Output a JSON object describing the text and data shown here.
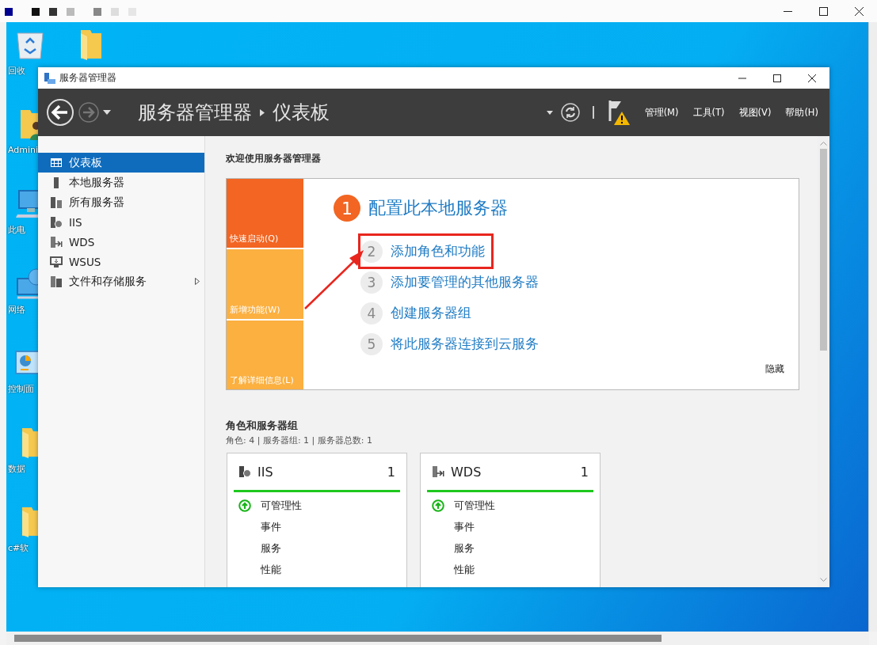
{
  "desktop_icons": [
    {
      "kind": "recycle-bin",
      "label": "回收"
    },
    {
      "kind": "folder"
    },
    {
      "kind": "user-folder",
      "label": "Admini"
    },
    {
      "kind": "computer",
      "label": "此电"
    },
    {
      "kind": "network",
      "label": "网络"
    },
    {
      "kind": "control-panel",
      "label": "控制面"
    },
    {
      "kind": "folder",
      "label": "数据"
    },
    {
      "kind": "folder",
      "label": "c#软"
    }
  ],
  "window": {
    "title": "服务器管理器"
  },
  "header": {
    "breadcrumb": [
      "服务器管理器",
      "仪表板"
    ],
    "menus": [
      "管理(M)",
      "工具(T)",
      "视图(V)",
      "帮助(H)"
    ]
  },
  "sidebar": {
    "items": [
      {
        "kind": "dashboard",
        "label": "仪表板",
        "selected": true,
        "has_submenu": false
      },
      {
        "kind": "server",
        "label": "本地服务器",
        "selected": false,
        "has_submenu": false
      },
      {
        "kind": "servers",
        "label": "所有服务器",
        "selected": false,
        "has_submenu": false
      },
      {
        "kind": "iis",
        "label": "IIS",
        "selected": false,
        "has_submenu": false
      },
      {
        "kind": "wds",
        "label": "WDS",
        "selected": false,
        "has_submenu": false
      },
      {
        "kind": "wsus",
        "label": "WSUS",
        "selected": false,
        "has_submenu": false
      },
      {
        "kind": "storage",
        "label": "文件和存储服务",
        "selected": false,
        "has_submenu": true
      }
    ]
  },
  "welcome": {
    "heading": "欢迎使用服务器管理器",
    "tiles": [
      {
        "label": "快速启动(Q)",
        "selected": true
      },
      {
        "label": "新增功能(W)",
        "selected": false
      },
      {
        "label": "了解详细信息(L)",
        "selected": false
      }
    ],
    "main_step": {
      "number": "1",
      "label": "配置此本地服务器"
    },
    "steps": [
      {
        "number": "2",
        "label": "添加角色和功能",
        "highlighted": true
      },
      {
        "number": "3",
        "label": "添加要管理的其他服务器",
        "highlighted": false
      },
      {
        "number": "4",
        "label": "创建服务器组",
        "highlighted": false
      },
      {
        "number": "5",
        "label": "将此服务器连接到云服务",
        "highlighted": false
      }
    ],
    "hide": "隐藏"
  },
  "roles": {
    "title": "角色和服务器组",
    "summary": "角色: 4 | 服务器组: 1 | 服务器总数: 1",
    "tiles": [
      {
        "kind": "iis",
        "name": "IIS",
        "count": "1",
        "rows": [
          {
            "label": "可管理性",
            "healthy": true
          },
          {
            "label": "事件",
            "healthy": false
          },
          {
            "label": "服务",
            "healthy": false
          },
          {
            "label": "性能",
            "healthy": false
          }
        ]
      },
      {
        "kind": "wds",
        "name": "WDS",
        "count": "1",
        "rows": [
          {
            "label": "可管理性",
            "healthy": true
          },
          {
            "label": "事件",
            "healthy": false
          },
          {
            "label": "服务",
            "healthy": false
          },
          {
            "label": "性能",
            "healthy": false
          }
        ]
      }
    ]
  }
}
